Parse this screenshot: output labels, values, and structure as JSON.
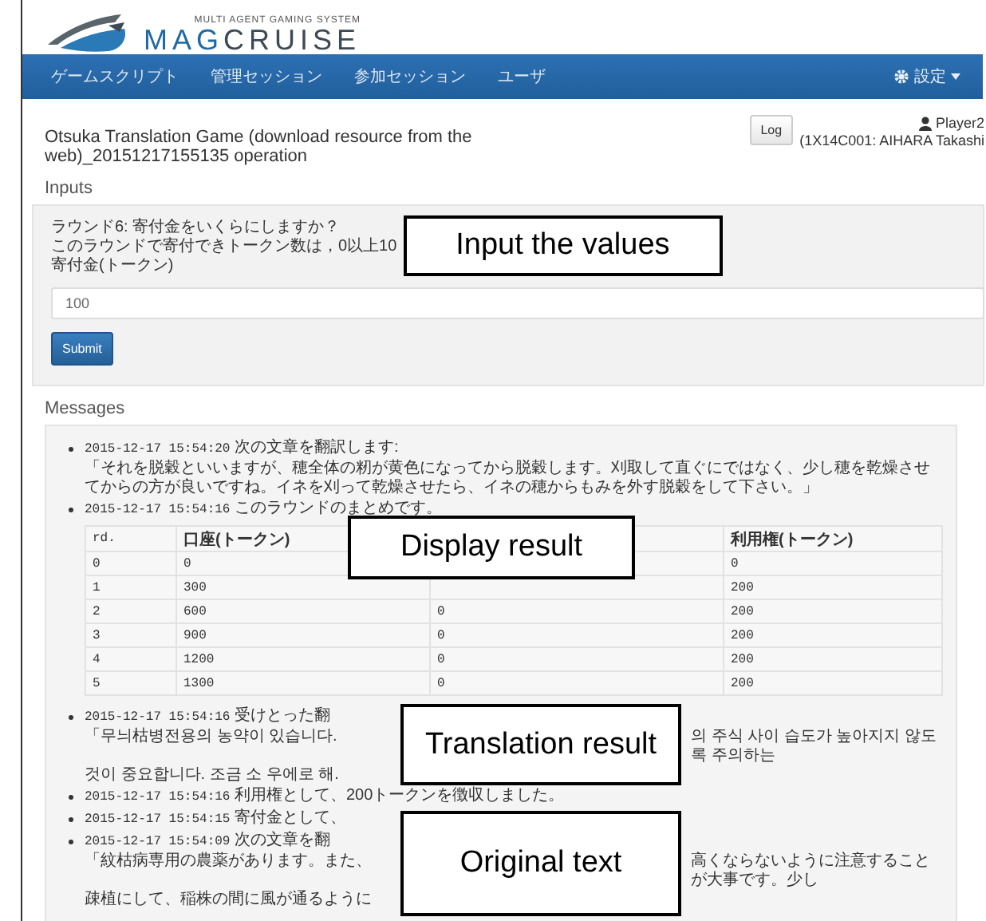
{
  "logo": {
    "tagline": "MULTI AGENT GAMING SYSTEM",
    "wordmark": [
      "MAG",
      "CRUISE"
    ]
  },
  "nav": {
    "items": [
      {
        "label": "ゲームスクリプト"
      },
      {
        "label": "管理セッション"
      },
      {
        "label": "参加セッション"
      },
      {
        "label": "ユーザ"
      }
    ],
    "settings": "設定"
  },
  "header": {
    "title": "Otsuka Translation Game (download resource from the web)_20151217155135 operation",
    "log_button": "Log",
    "player": "Player2",
    "player_detail": "(1X14C001: AIHARA Takashi"
  },
  "inputs": {
    "heading": "Inputs",
    "question": "ラウンド6: 寄付金をいくらにしますか？",
    "hint": "このラウンドで寄付できトークン数は，0以上10",
    "field_label": "寄付金(トークン)",
    "value": "100",
    "submit": "Submit"
  },
  "messages": {
    "heading": "Messages",
    "items": [
      {
        "time": "2015-12-17 15:54:20",
        "text": "次の文章を翻訳します:",
        "quote": "「それを脱穀といいますが、穂全体の籾が黄色になってから脱穀します。刈取して直ぐにではなく、少し穂を乾燥させてからの方が良いですね。イネを刈って乾燥させたら、イネの穂からもみを外す脱穀をして下さい。」"
      },
      {
        "time": "2015-12-17 15:54:16",
        "text": "このラウンドのまとめです。",
        "table": {
          "columns": [
            {
              "label": "rd."
            },
            {
              "label": "口座(トークン)"
            },
            {},
            {
              "label": "利用権(トークン)"
            }
          ],
          "rows": [
            {
              "rd": "0",
              "column_2": "0",
              "column_4": "0"
            },
            {
              "rd": "1",
              "column_2": "300",
              "column_4": "200"
            },
            {
              "rd": "2",
              "column_2": "600",
              "column_3": "0",
              "column_4": "200"
            },
            {
              "rd": "3",
              "column_2": "900",
              "column_3": "0",
              "column_4": "200"
            },
            {
              "rd": "4",
              "column_2": "1200",
              "column_3": "0",
              "column_4": "200"
            },
            {
              "rd": "5",
              "column_2": "1300",
              "column_3": "0",
              "column_4": "200"
            }
          ]
        }
      },
      {
        "time": "2015-12-17 15:54:16",
        "text": "受けとった翻",
        "quote_lines": [
          {
            "left": "「무늬枯병전용의 농약이 있습니다.",
            "right": "의 주식 사이 습도가 높아지지 않도록 주의하는"
          },
          {
            "left": "것이 중요합니다. 조금 소 우에로 해."
          }
        ]
      },
      {
        "time": "2015-12-17 15:54:16",
        "text": "利用権として、200トークンを徴収しました。"
      },
      {
        "time": "2015-12-17 15:54:15",
        "text": "寄付金として、"
      },
      {
        "time": "2015-12-17 15:54:09",
        "text": "次の文章を翻",
        "quote_lines": [
          {
            "left": "「紋枯病専用の農薬があります。また、",
            "right": "高くならないように注意することが大事です。少し"
          },
          {
            "left": "疎植にして、稲株の間に風が通るように"
          }
        ]
      }
    ]
  },
  "callouts": [
    {
      "text": "Input the values"
    },
    {
      "text": "Display result"
    },
    {
      "text": "Translation result"
    },
    {
      "text": "Original text"
    }
  ]
}
